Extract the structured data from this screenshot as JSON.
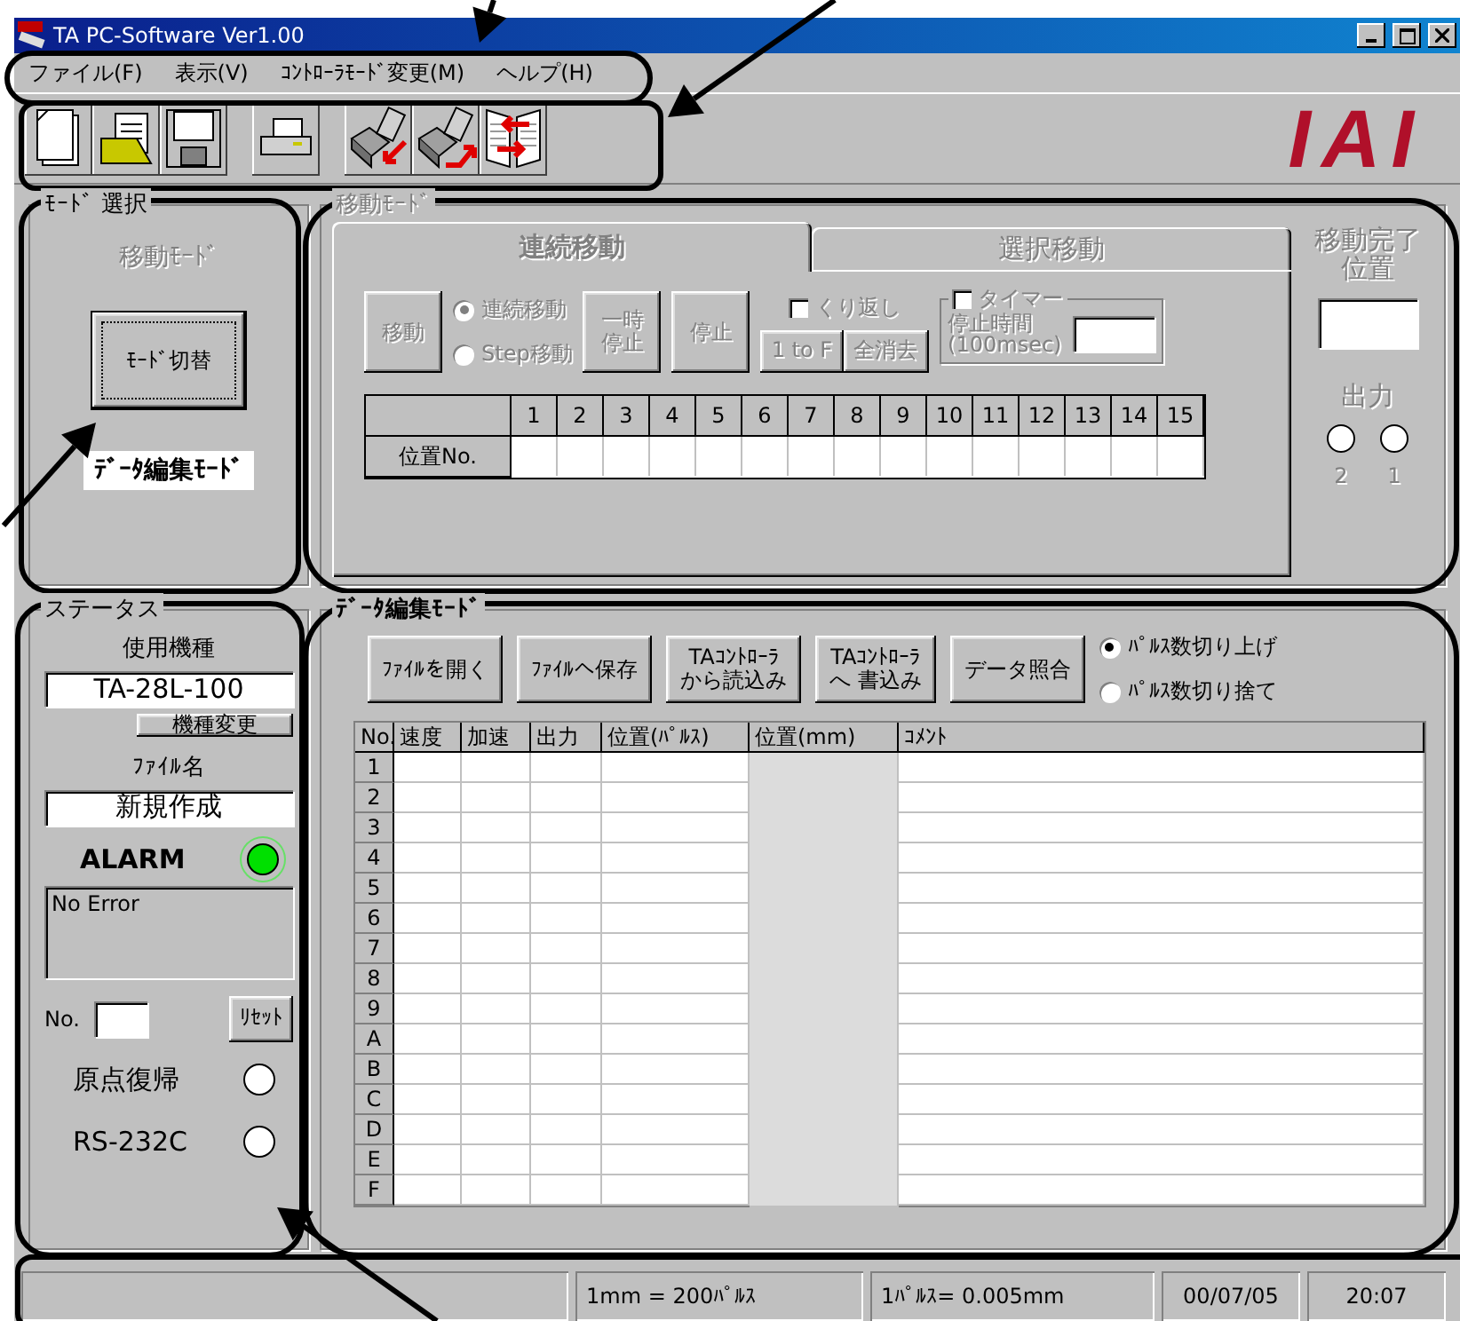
{
  "window": {
    "title": "TA PC-Software Ver1.00"
  },
  "menu": [
    "ファイル(F)",
    "表示(V)",
    "ｺﾝﾄﾛｰﾗﾓｰﾄﾞ変更(M)",
    "ヘルプ(H)"
  ],
  "logo": "IAI",
  "mode_select": {
    "title": "ﾓｰﾄﾞ 選択",
    "mode_label": "移動ﾓｰﾄﾞ",
    "switch_button": "ﾓｰﾄﾞ切替",
    "current_mode": "ﾃﾞｰﾀ編集ﾓｰﾄﾞ"
  },
  "move_mode": {
    "title": "移動ﾓｰﾄﾞ",
    "disabled": true,
    "tabs": [
      {
        "label": "連続移動",
        "selected": true
      },
      {
        "label": "選択移動",
        "selected": false
      }
    ],
    "move_button": "移動",
    "radios": [
      {
        "label": "連続移動",
        "selected": true
      },
      {
        "label": "Step移動",
        "selected": false
      }
    ],
    "pause_button": [
      "一時",
      "停止"
    ],
    "stop_button": "停止",
    "repeat": {
      "label": "くり返し",
      "checked": false
    },
    "buttons": [
      "1 to F",
      "全消去"
    ],
    "timer": {
      "label": "タイマー",
      "checked": false,
      "stop_time_label": "停止時間\n(100msec)"
    },
    "position_table": {
      "columns": [
        "1",
        "2",
        "3",
        "4",
        "5",
        "6",
        "7",
        "8",
        "9",
        "10",
        "11",
        "12",
        "13",
        "14",
        "15"
      ],
      "row_label": "位置No."
    },
    "done_label": [
      "移動完了",
      "位置"
    ],
    "output_label": "出力",
    "outputs": [
      {
        "label": "2",
        "on": false
      },
      {
        "label": "1",
        "on": false
      }
    ]
  },
  "status": {
    "title": "ステータス",
    "model_label": "使用機種",
    "model": "TA-28L-100",
    "change_button": "機種変更",
    "file_label": "ﾌｧｲﾙ名",
    "file": "新規作成",
    "alarm": {
      "label": "ALARM",
      "on": true
    },
    "message": "No Error",
    "no_label": "No.",
    "reset_button": "ﾘｾｯﾄ",
    "indicators": [
      {
        "label": "原点復帰",
        "on": false
      },
      {
        "label": "RS-232C",
        "on": false
      }
    ]
  },
  "data_edit": {
    "title": "ﾃﾞｰﾀ編集ﾓｰﾄﾞ",
    "buttons": [
      [
        "ﾌｧｲﾙを開く"
      ],
      [
        "ﾌｧｲﾙへ保存"
      ],
      [
        "TAｺﾝﾄﾛｰﾗ",
        "から読込み"
      ],
      [
        "TAｺﾝﾄﾛｰﾗ",
        "へ 書込み"
      ],
      [
        "データ照合"
      ]
    ],
    "rounding": [
      {
        "label": "ﾊﾟﾙｽ数切り上げ",
        "selected": true
      },
      {
        "label": "ﾊﾟﾙｽ数切り捨て",
        "selected": false
      }
    ],
    "table": {
      "columns": [
        "No.",
        "速度",
        "加速",
        "出力",
        "位置(ﾊﾟﾙｽ)",
        "位置(mm)",
        "ｺﾒﾝﾄ"
      ],
      "rows": [
        "1",
        "2",
        "3",
        "4",
        "5",
        "6",
        "7",
        "8",
        "9",
        "A",
        "B",
        "C",
        "D",
        "E",
        "F"
      ]
    }
  },
  "status_bar": [
    "1mm = 200ﾊﾟﾙｽ",
    "1ﾊﾟﾙｽ= 0.005mm",
    "00/07/05",
    "20:07"
  ]
}
